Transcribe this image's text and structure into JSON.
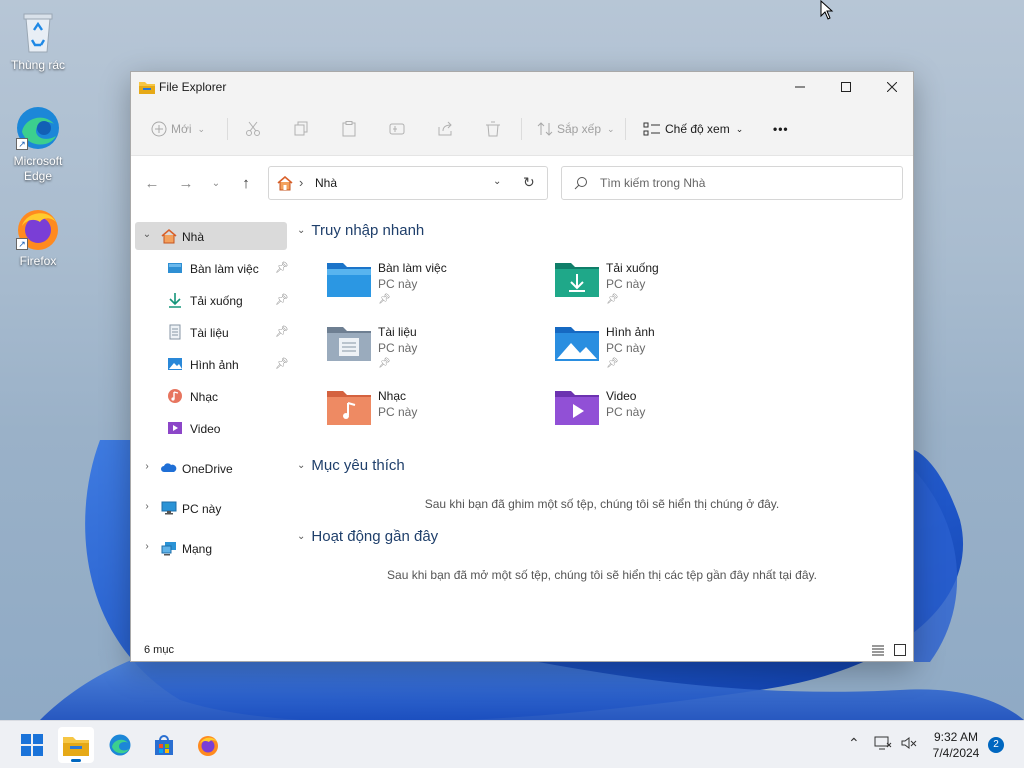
{
  "desktop": {
    "icons": [
      {
        "label": "Thùng rác",
        "icon": "recycle-bin-icon"
      },
      {
        "label": "Microsoft Edge",
        "icon": "edge-icon"
      },
      {
        "label": "Firefox",
        "icon": "firefox-icon"
      }
    ]
  },
  "window": {
    "title": "File Explorer",
    "commands": {
      "new": "Mới",
      "sort": "Sắp xếp",
      "view": "Chế độ xem",
      "more": "•••"
    },
    "nav": {
      "breadcrumb": "Nhà",
      "search_placeholder": "Tìm kiếm trong Nhà"
    },
    "sidebar": {
      "items": [
        {
          "label": "Nhà",
          "icon": "home-icon"
        },
        {
          "label": "Bàn làm việc",
          "icon": "desktop-folder-icon"
        },
        {
          "label": "Tải xuống",
          "icon": "download-icon"
        },
        {
          "label": "Tài liệu",
          "icon": "document-icon"
        },
        {
          "label": "Hình ảnh",
          "icon": "picture-icon"
        },
        {
          "label": "Nhạc",
          "icon": "music-icon"
        },
        {
          "label": "Video",
          "icon": "video-icon"
        },
        {
          "label": "OneDrive",
          "icon": "cloud-icon"
        },
        {
          "label": "PC này",
          "icon": "pc-icon"
        },
        {
          "label": "Mạng",
          "icon": "network-icon"
        }
      ]
    },
    "quick_access": {
      "header": "Truy nhập nhanh",
      "items": [
        {
          "name": "Bàn làm việc",
          "location": "PC này",
          "pinned": true
        },
        {
          "name": "Tải xuống",
          "location": "PC này",
          "pinned": true
        },
        {
          "name": "Tài liệu",
          "location": "PC này",
          "pinned": true
        },
        {
          "name": "Hình ảnh",
          "location": "PC này",
          "pinned": true
        },
        {
          "name": "Nhạc",
          "location": "PC này",
          "pinned": false
        },
        {
          "name": "Video",
          "location": "PC này",
          "pinned": false
        }
      ]
    },
    "favorites": {
      "header": "Mục yêu thích",
      "empty_text": "Sau khi bạn đã ghim một số tệp, chúng tôi sẽ hiển thị chúng ở đây."
    },
    "recent": {
      "header": "Hoạt động gần đây",
      "empty_text": "Sau khi bạn đã mở một số tệp, chúng tôi sẽ hiển thị các tệp gần đây nhất tại đây."
    },
    "status": {
      "count": "6 mục"
    }
  },
  "taskbar": {
    "apps": [
      "start-icon",
      "file-explorer-icon",
      "edge-icon",
      "store-icon",
      "firefox-icon"
    ],
    "time": "9:32 AM",
    "date": "7/4/2024",
    "notifications": "2"
  }
}
